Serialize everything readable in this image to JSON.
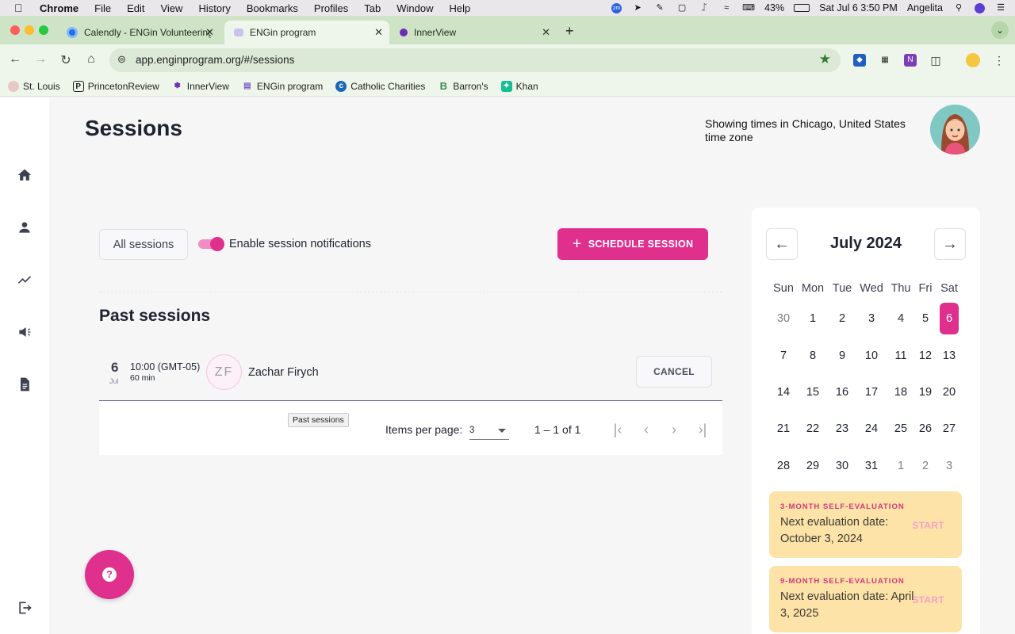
{
  "menubar": {
    "app": "Chrome",
    "items": [
      "File",
      "Edit",
      "View",
      "History",
      "Bookmarks",
      "Profiles",
      "Tab",
      "Window",
      "Help"
    ],
    "battery": "43%",
    "datetime": "Sat Jul 6  3:50 PM",
    "user": "Angelita"
  },
  "tabs": [
    {
      "title": "Calendly - ENGin Volunteering",
      "favicon_color": "#1a73e8"
    },
    {
      "title": "ENGin program",
      "favicon_color": "#7b61c9",
      "active": true
    },
    {
      "title": "InnerView",
      "favicon_color": "#6a2fb3"
    }
  ],
  "address": {
    "url": "app.enginprogram.org/#/sessions"
  },
  "bookmarks": [
    "St. Louis",
    "PrincetonReview",
    "InnerView",
    "ENGin program",
    "Catholic Charities",
    "Barron's",
    "Khan"
  ],
  "page": {
    "title": "Sessions",
    "timezone_note": "Showing times in Chicago, United States time zone"
  },
  "controls": {
    "filter_label": "All sessions",
    "notifications_label": "Enable session notifications",
    "notifications_enabled": true,
    "schedule_label": "SCHEDULE SESSION"
  },
  "past": {
    "title": "Past sessions",
    "sessions": [
      {
        "day": "6",
        "month": "Jul",
        "time": "10:00 (GMT-05)",
        "duration": "60 min",
        "initials": "ZF",
        "name": "Zachar Firych",
        "action": "CANCEL"
      }
    ]
  },
  "paginator": {
    "tooltip": "Past sessions",
    "items_per_page_label": "Items per page:",
    "items_per_page": "3",
    "range": "1 – 1 of 1"
  },
  "calendar": {
    "month_label": "July 2024",
    "weekdays": [
      "Sun",
      "Mon",
      "Tue",
      "Wed",
      "Thu",
      "Fri",
      "Sat"
    ],
    "weeks": [
      [
        "30",
        "1",
        "2",
        "3",
        "4",
        "5",
        "6"
      ],
      [
        "7",
        "8",
        "9",
        "10",
        "11",
        "12",
        "13"
      ],
      [
        "14",
        "15",
        "16",
        "17",
        "18",
        "19",
        "20"
      ],
      [
        "21",
        "22",
        "23",
        "24",
        "25",
        "26",
        "27"
      ],
      [
        "28",
        "29",
        "30",
        "31",
        "1",
        "2",
        "3"
      ]
    ],
    "selected_day": "6",
    "accent": "#e0308e"
  },
  "evaluations": [
    {
      "tag": "3-MONTH SELF-EVALUATION",
      "text": "Next evaluation date: October 3, 2024",
      "action": "START"
    },
    {
      "tag": "9-MONTH SELF-EVALUATION",
      "text": "Next evaluation date: April 3, 2025",
      "action": "START"
    }
  ]
}
